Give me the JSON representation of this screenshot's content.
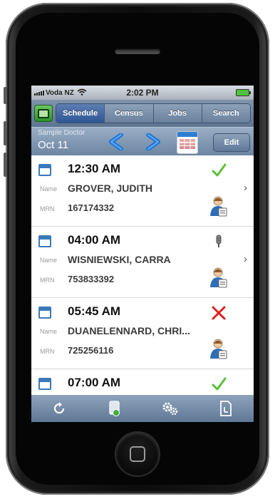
{
  "status_bar": {
    "carrier": "Voda NZ",
    "time": "2:02 PM"
  },
  "nav": {
    "segments": [
      "Schedule",
      "Census",
      "Jobs",
      "Search"
    ],
    "active": "Schedule"
  },
  "date_bar": {
    "doctor": "Sample Doctor",
    "date": "Oct 11",
    "edit_label": "Edit"
  },
  "labels": {
    "name": "Name",
    "mrn": "MRN"
  },
  "appointments": [
    {
      "time": "12:30 AM",
      "name": "GROVER, JUDITH",
      "mrn": "167174332",
      "status": "check-icon"
    },
    {
      "time": "04:00 AM",
      "name": "WISNIEWSKI, CARRA",
      "mrn": "753833392",
      "status": "microphone-icon"
    },
    {
      "time": "05:45 AM",
      "name": "DUANELENNARD, CHRI...",
      "mrn": "725256116",
      "status": "cross-icon"
    },
    {
      "time": "07:00 AM",
      "status": "check-icon"
    }
  ],
  "colors": {
    "nav_bar": "#6f86a3",
    "active_segment": "#3f66a3",
    "check": "#5bbf3a",
    "cross": "#e01e1e"
  }
}
